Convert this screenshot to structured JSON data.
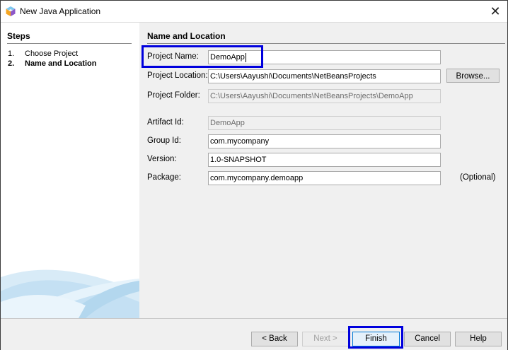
{
  "window": {
    "title": "New Java Application"
  },
  "steps": {
    "header": "Steps",
    "items": [
      {
        "num": "1.",
        "label": "Choose Project"
      },
      {
        "num": "2.",
        "label": "Name and Location"
      }
    ]
  },
  "form": {
    "header": "Name and Location",
    "project_name": {
      "label": "Project Name:",
      "value": "DemoApp"
    },
    "project_location": {
      "label": "Project Location:",
      "value": "C:\\Users\\Aayushi\\Documents\\NetBeansProjects"
    },
    "browse_label": "Browse...",
    "project_folder": {
      "label": "Project Folder:",
      "value": "C:\\Users\\Aayushi\\Documents\\NetBeansProjects\\DemoApp"
    },
    "artifact_id": {
      "label": "Artifact Id:",
      "value": "DemoApp"
    },
    "group_id": {
      "label": "Group Id:",
      "value": "com.mycompany"
    },
    "version": {
      "label": "Version:",
      "value": "1.0-SNAPSHOT"
    },
    "package": {
      "label": "Package:",
      "value": "com.mycompany.demoapp",
      "optional_label": "(Optional)"
    }
  },
  "buttons": {
    "back": "< Back",
    "next": "Next >",
    "finish": "Finish",
    "cancel": "Cancel",
    "help": "Help"
  },
  "colors": {
    "highlight": "#0000dd",
    "accent": "#0078d7"
  },
  "icons": {
    "app": "netbeans-cube-icon",
    "close": "close-icon"
  }
}
